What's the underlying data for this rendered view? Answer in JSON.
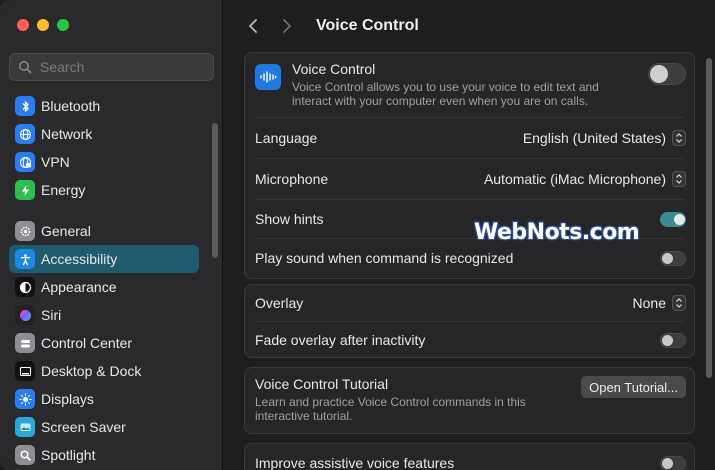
{
  "window": {
    "title": "Voice Control"
  },
  "search": {
    "placeholder": "Search"
  },
  "sidebar": {
    "group1": [
      {
        "label": "Bluetooth",
        "icon": "bluetooth-icon",
        "color": "#2b7cf0"
      },
      {
        "label": "Network",
        "icon": "globe-icon",
        "color": "#2b7cf0"
      },
      {
        "label": "VPN",
        "icon": "vpn-icon",
        "color": "#2b7cf0"
      },
      {
        "label": "Energy",
        "icon": "bolt-icon",
        "color": "#2fbf4f"
      }
    ],
    "group2": [
      {
        "label": "General",
        "icon": "gear-icon",
        "color": "#8e8e93"
      },
      {
        "label": "Accessibility",
        "icon": "accessibility-icon",
        "color": "#1e88e5",
        "active": true
      },
      {
        "label": "Appearance",
        "icon": "appearance-icon",
        "color": "#111111"
      },
      {
        "label": "Siri",
        "icon": "siri-icon",
        "color": "#222222"
      },
      {
        "label": "Control Center",
        "icon": "control-center-icon",
        "color": "#8e8e93"
      },
      {
        "label": "Desktop & Dock",
        "icon": "dock-icon",
        "color": "#111111"
      },
      {
        "label": "Displays",
        "icon": "sun-icon",
        "color": "#2b7cf0"
      },
      {
        "label": "Screen Saver",
        "icon": "screensaver-icon",
        "color": "#2aa9d8"
      },
      {
        "label": "Spotlight",
        "icon": "magnifier-icon",
        "color": "#8e8e93"
      }
    ]
  },
  "main": {
    "title": "Voice Control",
    "header": {
      "title": "Voice Control",
      "description_line1": "Voice Control allows you to use your voice to edit text and",
      "description_line2": "interact with your computer even when you are on calls.",
      "enabled": false
    },
    "language": {
      "label": "Language",
      "value": "English (United States)"
    },
    "microphone": {
      "label": "Microphone",
      "value": "Automatic (iMac Microphone)"
    },
    "show_hints": {
      "label": "Show hints",
      "enabled": true
    },
    "play_sound": {
      "label": "Play sound when command is recognized",
      "enabled": false
    },
    "overlay": {
      "label": "Overlay",
      "value": "None"
    },
    "fade_overlay": {
      "label": "Fade overlay after inactivity",
      "enabled": false
    },
    "tutorial": {
      "label": "Voice Control Tutorial",
      "description_line1": "Learn and practice Voice Control commands in this",
      "description_line2": "interactive tutorial.",
      "button": "Open Tutorial..."
    },
    "improve": {
      "label": "Improve assistive voice features",
      "enabled": false
    }
  },
  "watermark": "WebNots.com",
  "colors": {
    "accent": "#3a8c8f",
    "sidebar_active": "#1f5b6e"
  }
}
